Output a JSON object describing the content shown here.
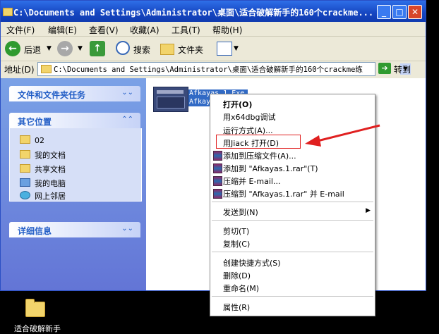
{
  "window": {
    "title": "C:\\Documents and Settings\\Administrator\\桌面\\适合破解新手的160个crackme..."
  },
  "menubar": {
    "items": [
      "文件(F)",
      "编辑(E)",
      "查看(V)",
      "收藏(A)",
      "工具(T)",
      "帮助(H)"
    ]
  },
  "toolbar": {
    "back": "后退",
    "search": "搜索",
    "folders": "文件夹"
  },
  "address": {
    "label": "地址(D)",
    "path": "C:\\Documents and Settings\\Administrator\\桌面\\适合破解新手的160个crackme练",
    "go": "转到"
  },
  "leftpane": {
    "tasks_title": "文件和文件夹任务",
    "places_title": "其它位置",
    "places": [
      "02",
      "我的文档",
      "共享文档",
      "我的电脑",
      "网上邻居"
    ],
    "details_title": "详细信息"
  },
  "file": {
    "name_line1": "Afkayas.1.Exe",
    "name_line2": "Afkay"
  },
  "context_menu": {
    "open": "打开(O)",
    "x64dbg": "用x64dbg调试",
    "run_as": "运行方式(A)...",
    "jiack": "用Jiack  打开(D)",
    "add_archive": "添加到压缩文件(A)...",
    "add_rar": "添加到 \"Afkayas.1.rar\"(T)",
    "compress_email": "压缩并 E-mail...",
    "compress_rar_email": "压缩到 \"Afkayas.1.rar\" 并 E-mail",
    "send_to": "发送到(N)",
    "cut": "剪切(T)",
    "copy": "复制(C)",
    "shortcut": "创建快捷方式(S)",
    "delete": "删除(D)",
    "rename": "重命名(M)",
    "properties": "属性(R)"
  },
  "desktop": {
    "icon_label": "适合破解新手"
  },
  "colors": {
    "titlebar": "#1545c0",
    "highlight": "#e02020",
    "selection": "#316ac5"
  }
}
